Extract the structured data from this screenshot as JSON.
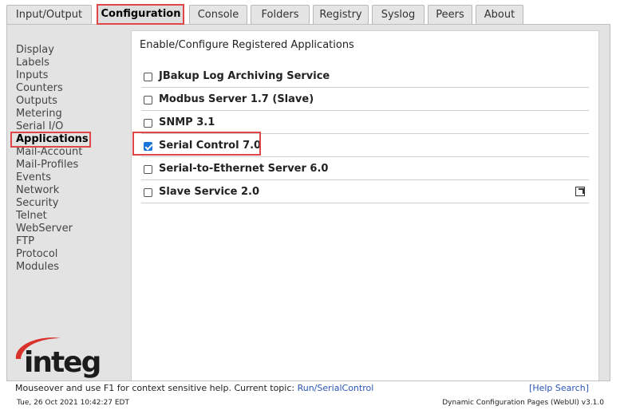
{
  "tabs": [
    "Input/Output",
    "Configuration",
    "Console",
    "Folders",
    "Registry",
    "Syslog",
    "Peers",
    "About"
  ],
  "active_tab": "Configuration",
  "sidenav": {
    "items": [
      "Display",
      "Labels",
      "Inputs",
      "Counters",
      "Outputs",
      "Metering",
      "Serial I/O",
      "Applications",
      "Mail-Account",
      "Mail-Profiles",
      "Events",
      "Network",
      "Security",
      "Telnet",
      "WebServer",
      "FTP",
      "Protocol",
      "Modules"
    ],
    "active": "Applications"
  },
  "content": {
    "title": "Enable/Configure Registered Applications",
    "apps": [
      {
        "label": "JBakup Log Archiving Service",
        "checked": false
      },
      {
        "label": "Modbus Server 1.7 (Slave)",
        "checked": false
      },
      {
        "label": "SNMP 3.1",
        "checked": false
      },
      {
        "label": "Serial Control 7.0",
        "checked": true
      },
      {
        "label": "Serial-to-Ethernet Server 6.0",
        "checked": false
      },
      {
        "label": "Slave Service 2.0",
        "checked": false
      }
    ]
  },
  "logo": {
    "text": "integ",
    "swoosh_color": "#d9322c"
  },
  "help_bar": {
    "text": "Mouseover and use F1 for context sensitive help. Current topic: ",
    "topic": "Run/SerialControl",
    "help_search": "[Help Search]"
  },
  "status_bar": {
    "datetime": "Tue, 26 Oct 2021 10:42:27 EDT",
    "version": "Dynamic Configuration Pages (WebUI) v3.1.0"
  },
  "colors": {
    "highlight": "#e0454a",
    "link": "#2a55b8",
    "checkbox": "#1a73d9"
  }
}
